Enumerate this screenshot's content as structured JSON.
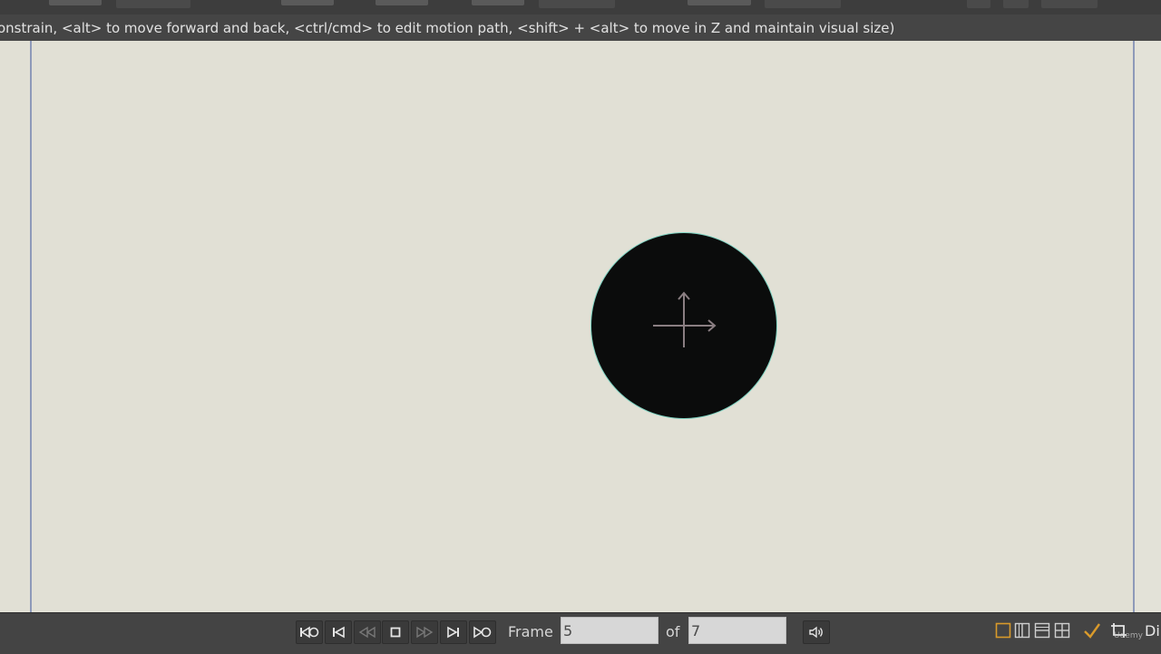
{
  "help_line": {
    "text": "onstrain, <alt> to move forward and back, <ctrl/cmd> to edit motion path, <shift> + <alt> to move in Z and maintain visual size)"
  },
  "colors": {
    "stage_bg": "#e1e0d5",
    "stage_edge": "#8e9ab9",
    "ball_fill": "#0b0c0c",
    "ball_outline": "#7fd3c2",
    "bar_bg": "#444444",
    "accent": "#d99a2b"
  },
  "stage": {
    "object": "circle",
    "manipulator_icon": "move-manipulator-icon"
  },
  "playback": {
    "buttons": [
      {
        "name": "rewind-to-start-button",
        "icon": "rewind-start-icon"
      },
      {
        "name": "previous-keyframe-button",
        "icon": "step-back-icon"
      },
      {
        "name": "play-backward-button",
        "icon": "play-backward-icon"
      },
      {
        "name": "stop-button",
        "icon": "stop-icon"
      },
      {
        "name": "play-forward-button",
        "icon": "play-forward-icon"
      },
      {
        "name": "next-keyframe-button",
        "icon": "step-forward-icon"
      },
      {
        "name": "forward-to-end-button",
        "icon": "forward-end-icon"
      }
    ],
    "frame_label": "Frame",
    "frame_value": "5",
    "of_label": "of",
    "total_frames": "7",
    "audio_icon": "speaker-icon"
  },
  "right_toolbar": {
    "icons": [
      "single-view-icon",
      "two-views-icon",
      "split-horizontal-icon",
      "four-views-icon",
      "checkmark-icon",
      "crop-icon"
    ],
    "truncated_label": "Di"
  },
  "watermark": "Udemy"
}
